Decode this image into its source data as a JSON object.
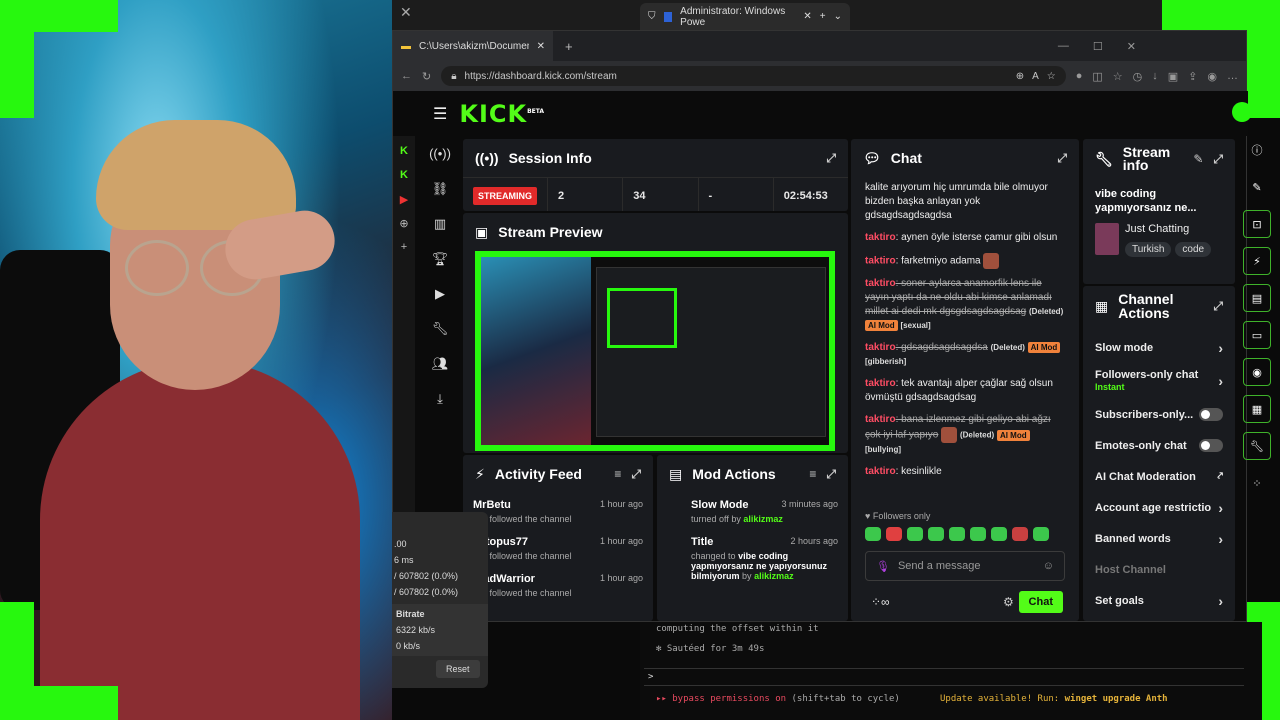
{
  "admin_tab": {
    "title": "Administrator: Windows Powe"
  },
  "browser": {
    "tab_title": "C:\\Users\\akizm\\Documents\\G",
    "url": "https://dashboard.kick.com/stream"
  },
  "kick": {
    "logo": "KICK",
    "beta": "BETA"
  },
  "session_info": {
    "title": "Session Info",
    "status": "STREAMING",
    "stats": [
      "2",
      "34",
      "-",
      "02:54:53"
    ]
  },
  "stream_preview": {
    "title": "Stream Preview"
  },
  "activity_feed": {
    "title": "Activity Feed",
    "items": [
      {
        "name": "MrBetu",
        "time": "1 hour ago",
        "text": "just followed the channel"
      },
      {
        "name": "octopus77",
        "time": "1 hour ago",
        "text": "just followed the channel"
      },
      {
        "name": "TradWarrior",
        "time": "1 hour ago",
        "text": "just followed the channel"
      }
    ]
  },
  "mod_actions": {
    "title": "Mod Actions",
    "items": [
      {
        "title": "Slow Mode",
        "time": "3 minutes ago",
        "text": "turned off by",
        "user": "alikizmaz"
      },
      {
        "title": "Title",
        "time": "2 hours ago",
        "text": "changed to",
        "value": "vibe coding yapmıyorsanız ne yapıyorsunuz bilmiyorum",
        "by": "by",
        "user": "alikizmaz"
      }
    ]
  },
  "chat": {
    "title": "Chat",
    "lines": [
      {
        "text": "kalite arıyorum hiç umrumda bile olmuyor bizden başka anlayan yok gdsagdsagdsagdsa"
      },
      {
        "user": "taktiro",
        "text": ": aynen öyle isterse çamur gibi olsun"
      },
      {
        "user": "taktiro",
        "text": ": farketmiyo adama"
      },
      {
        "user": "taktiro",
        "text": ": soner aylarca anamorfik lens ile yayın yaptı da ne oldu abi kimse anlamadı millet ai dedi mk dgsgdsagdsagdsag",
        "deleted": "(Deleted)",
        "mod": "AI Mod",
        "reason": "[sexual]"
      },
      {
        "user": "taktiro",
        "text": ": gdsagdsagdsagdsa",
        "deleted": "(Deleted)",
        "mod": "AI Mod",
        "reason": "[gibberish]"
      },
      {
        "user": "taktiro",
        "text": ": tek avantajı alper çağlar sağ olsun övmüştü gdsagdsagdsag"
      },
      {
        "user": "taktiro",
        "text": ": bana izlenmez gibi geliyo abi ağzı çok iyi laf yapıyo",
        "deleted": "(Deleted)",
        "mod": "AI Mod",
        "reason": "[bullying]"
      },
      {
        "user": "taktiro",
        "text": ": kesinlikle"
      }
    ],
    "followers_only": "Followers only",
    "placeholder": "Send a message",
    "send": "Chat"
  },
  "stream_info": {
    "title": "Stream info",
    "stream_title": "vibe coding yapmıyorsanız ne...",
    "category": "Just Chatting",
    "tags": [
      "Turkish",
      "code"
    ]
  },
  "channel_actions": {
    "title": "Channel Actions",
    "items": [
      {
        "label": "Slow mode",
        "control": "chevron"
      },
      {
        "label": "Followers-only chat",
        "sub": "Instant",
        "control": "chevron"
      },
      {
        "label": "Subscribers-only...",
        "control": "toggle"
      },
      {
        "label": "Emotes-only chat",
        "control": "toggle"
      },
      {
        "label": "AI Chat Moderation",
        "control": "external"
      },
      {
        "label": "Account age restrictio",
        "control": "chevron"
      },
      {
        "label": "Banned words",
        "control": "chevron"
      },
      {
        "label": "Host Channel",
        "control": "none"
      },
      {
        "label": "Set goals",
        "control": "chevron"
      }
    ]
  },
  "terminal": {
    "line1": "computing the offset within it",
    "line2": "Sautéed for 3m 49s",
    "prompt": ">",
    "line3": "bypass permissions on",
    "line3b": "(shift+tab to cycle)",
    "update": "Update available! Run:",
    "cmd": "winget upgrade Anth"
  },
  "stats_overlay": {
    "lines": [
      ".00",
      "6 ms",
      "/ 607802 (0.0%)",
      "/ 607802 (0.0%)"
    ],
    "bitrate_label": "Bitrate",
    "bitrate_lines": [
      "6322 kb/s",
      "0 kb/s"
    ],
    "reset": "Reset"
  },
  "colors": {
    "kick_green": "#53fc18",
    "frame_green": "#27f80e",
    "live_red": "#e12a2a",
    "ai_mod_orange": "#f0823b",
    "chat_user": "#ff4d64"
  }
}
